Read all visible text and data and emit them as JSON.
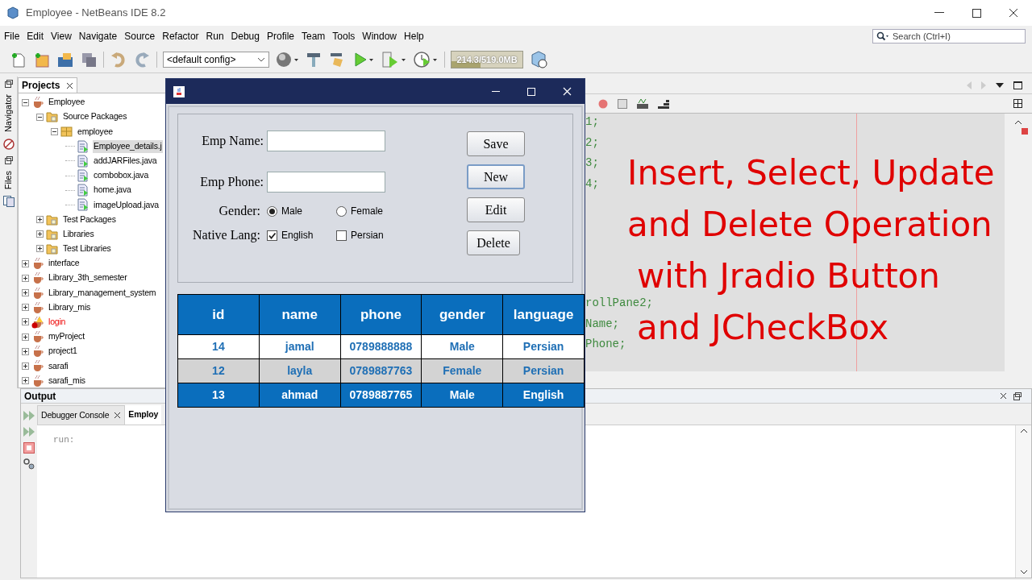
{
  "window": {
    "title": "Employee - NetBeans IDE 8.2"
  },
  "menu": [
    "File",
    "Edit",
    "View",
    "Navigate",
    "Source",
    "Refactor",
    "Run",
    "Debug",
    "Profile",
    "Team",
    "Tools",
    "Window",
    "Help"
  ],
  "search": {
    "placeholder": "Search (Ctrl+I)"
  },
  "toolbar": {
    "config": "<default config>",
    "memory": "214.3/519.0MB",
    "level": 0.41
  },
  "side_tabs": [
    "Navigator",
    "Files"
  ],
  "projects": {
    "title": "Projects",
    "tree": [
      {
        "label": "Employee",
        "kind": "project",
        "expanded": true,
        "selected": false,
        "error": false,
        "children": [
          {
            "label": "Source Packages",
            "kind": "folder",
            "expanded": true,
            "selected": false,
            "error": false,
            "children": [
              {
                "label": "employee",
                "kind": "package",
                "expanded": true,
                "selected": false,
                "error": false,
                "children": [
                  {
                    "label": "Employee_details.j",
                    "kind": "file",
                    "selected": true,
                    "error": false
                  },
                  {
                    "label": "addJARFiles.java",
                    "kind": "file",
                    "selected": false,
                    "error": false
                  },
                  {
                    "label": "combobox.java",
                    "kind": "file",
                    "selected": false,
                    "error": false
                  },
                  {
                    "label": "home.java",
                    "kind": "file",
                    "selected": false,
                    "error": false
                  },
                  {
                    "label": "imageUpload.java",
                    "kind": "file",
                    "selected": false,
                    "error": false
                  }
                ]
              }
            ]
          },
          {
            "label": "Test Packages",
            "kind": "folder",
            "expanded": false,
            "selected": false,
            "error": false
          },
          {
            "label": "Libraries",
            "kind": "folder",
            "expanded": false,
            "selected": false,
            "error": false
          },
          {
            "label": "Test Libraries",
            "kind": "folder",
            "expanded": false,
            "selected": false,
            "error": false
          }
        ]
      },
      {
        "label": "interface",
        "kind": "project",
        "expanded": false,
        "selected": false,
        "error": false
      },
      {
        "label": "Library_3th_semester",
        "kind": "project",
        "expanded": false,
        "selected": false,
        "error": false
      },
      {
        "label": "Library_management_system",
        "kind": "project",
        "expanded": false,
        "selected": false,
        "error": false
      },
      {
        "label": "Library_mis",
        "kind": "project",
        "expanded": false,
        "selected": false,
        "error": false
      },
      {
        "label": "login",
        "kind": "project",
        "expanded": false,
        "selected": false,
        "error": true
      },
      {
        "label": "myProject",
        "kind": "project",
        "expanded": false,
        "selected": false,
        "error": false
      },
      {
        "label": "project1",
        "kind": "project",
        "expanded": false,
        "selected": false,
        "error": false
      },
      {
        "label": "sarafi",
        "kind": "project",
        "expanded": false,
        "selected": false,
        "error": false
      },
      {
        "label": "sarafi_mis",
        "kind": "project",
        "expanded": false,
        "selected": false,
        "error": false
      }
    ]
  },
  "editor": {
    "code_top": [
      "1;",
      "2;",
      "3;",
      "4;"
    ],
    "code_bottom": [
      "rollPane2;",
      "Name;",
      "Phone;"
    ],
    "overlay_text": [
      "Insert, Select, Update",
      "and Delete Operation",
      "with Jradio Button",
      "and JCheckBox"
    ]
  },
  "output": {
    "title": "Output",
    "tabs": [
      {
        "label": "Debugger Console",
        "selected": false
      },
      {
        "label": "Employ",
        "selected": true
      }
    ],
    "console": "run:"
  },
  "dialog": {
    "form": {
      "name_label": "Emp Name:",
      "phone_label": "Emp Phone:",
      "gender_label": "Gender:",
      "genders": [
        {
          "label": "Male",
          "selected": true
        },
        {
          "label": "Female",
          "selected": false
        }
      ],
      "lang_label": "Native Lang:",
      "languages": [
        {
          "label": "English",
          "checked": true
        },
        {
          "label": "Persian",
          "checked": false
        }
      ]
    },
    "buttons": [
      {
        "label": "Save",
        "focused": false
      },
      {
        "label": "New",
        "focused": true
      },
      {
        "label": "Edit",
        "focused": false
      },
      {
        "label": "Delete",
        "focused": false
      }
    ],
    "table": {
      "columns": [
        "id",
        "name",
        "phone",
        "gender",
        "language"
      ],
      "rows": [
        {
          "cells": [
            "14",
            "jamal",
            "0789888888",
            "Male",
            "Persian"
          ],
          "selected": false
        },
        {
          "cells": [
            "12",
            "layla",
            "0789887763",
            "Female",
            "Persian"
          ],
          "selected": false
        },
        {
          "cells": [
            "13",
            "ahmad",
            "0789887765",
            "Male",
            "English"
          ],
          "selected": true
        }
      ]
    }
  }
}
